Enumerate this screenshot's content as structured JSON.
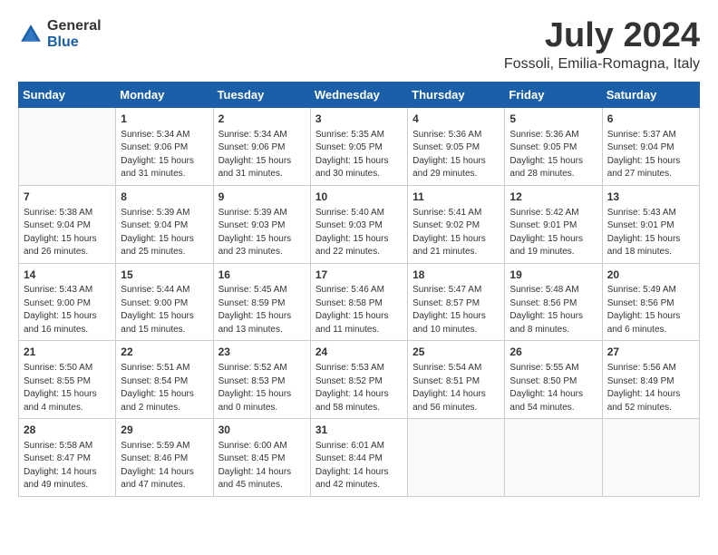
{
  "logo": {
    "general": "General",
    "blue": "Blue"
  },
  "title": "July 2024",
  "location": "Fossoli, Emilia-Romagna, Italy",
  "weekdays": [
    "Sunday",
    "Monday",
    "Tuesday",
    "Wednesday",
    "Thursday",
    "Friday",
    "Saturday"
  ],
  "weeks": [
    [
      {
        "day": "",
        "info": ""
      },
      {
        "day": "1",
        "info": "Sunrise: 5:34 AM\nSunset: 9:06 PM\nDaylight: 15 hours\nand 31 minutes."
      },
      {
        "day": "2",
        "info": "Sunrise: 5:34 AM\nSunset: 9:06 PM\nDaylight: 15 hours\nand 31 minutes."
      },
      {
        "day": "3",
        "info": "Sunrise: 5:35 AM\nSunset: 9:05 PM\nDaylight: 15 hours\nand 30 minutes."
      },
      {
        "day": "4",
        "info": "Sunrise: 5:36 AM\nSunset: 9:05 PM\nDaylight: 15 hours\nand 29 minutes."
      },
      {
        "day": "5",
        "info": "Sunrise: 5:36 AM\nSunset: 9:05 PM\nDaylight: 15 hours\nand 28 minutes."
      },
      {
        "day": "6",
        "info": "Sunrise: 5:37 AM\nSunset: 9:04 PM\nDaylight: 15 hours\nand 27 minutes."
      }
    ],
    [
      {
        "day": "7",
        "info": "Sunrise: 5:38 AM\nSunset: 9:04 PM\nDaylight: 15 hours\nand 26 minutes."
      },
      {
        "day": "8",
        "info": "Sunrise: 5:39 AM\nSunset: 9:04 PM\nDaylight: 15 hours\nand 25 minutes."
      },
      {
        "day": "9",
        "info": "Sunrise: 5:39 AM\nSunset: 9:03 PM\nDaylight: 15 hours\nand 23 minutes."
      },
      {
        "day": "10",
        "info": "Sunrise: 5:40 AM\nSunset: 9:03 PM\nDaylight: 15 hours\nand 22 minutes."
      },
      {
        "day": "11",
        "info": "Sunrise: 5:41 AM\nSunset: 9:02 PM\nDaylight: 15 hours\nand 21 minutes."
      },
      {
        "day": "12",
        "info": "Sunrise: 5:42 AM\nSunset: 9:01 PM\nDaylight: 15 hours\nand 19 minutes."
      },
      {
        "day": "13",
        "info": "Sunrise: 5:43 AM\nSunset: 9:01 PM\nDaylight: 15 hours\nand 18 minutes."
      }
    ],
    [
      {
        "day": "14",
        "info": "Sunrise: 5:43 AM\nSunset: 9:00 PM\nDaylight: 15 hours\nand 16 minutes."
      },
      {
        "day": "15",
        "info": "Sunrise: 5:44 AM\nSunset: 9:00 PM\nDaylight: 15 hours\nand 15 minutes."
      },
      {
        "day": "16",
        "info": "Sunrise: 5:45 AM\nSunset: 8:59 PM\nDaylight: 15 hours\nand 13 minutes."
      },
      {
        "day": "17",
        "info": "Sunrise: 5:46 AM\nSunset: 8:58 PM\nDaylight: 15 hours\nand 11 minutes."
      },
      {
        "day": "18",
        "info": "Sunrise: 5:47 AM\nSunset: 8:57 PM\nDaylight: 15 hours\nand 10 minutes."
      },
      {
        "day": "19",
        "info": "Sunrise: 5:48 AM\nSunset: 8:56 PM\nDaylight: 15 hours\nand 8 minutes."
      },
      {
        "day": "20",
        "info": "Sunrise: 5:49 AM\nSunset: 8:56 PM\nDaylight: 15 hours\nand 6 minutes."
      }
    ],
    [
      {
        "day": "21",
        "info": "Sunrise: 5:50 AM\nSunset: 8:55 PM\nDaylight: 15 hours\nand 4 minutes."
      },
      {
        "day": "22",
        "info": "Sunrise: 5:51 AM\nSunset: 8:54 PM\nDaylight: 15 hours\nand 2 minutes."
      },
      {
        "day": "23",
        "info": "Sunrise: 5:52 AM\nSunset: 8:53 PM\nDaylight: 15 hours\nand 0 minutes."
      },
      {
        "day": "24",
        "info": "Sunrise: 5:53 AM\nSunset: 8:52 PM\nDaylight: 14 hours\nand 58 minutes."
      },
      {
        "day": "25",
        "info": "Sunrise: 5:54 AM\nSunset: 8:51 PM\nDaylight: 14 hours\nand 56 minutes."
      },
      {
        "day": "26",
        "info": "Sunrise: 5:55 AM\nSunset: 8:50 PM\nDaylight: 14 hours\nand 54 minutes."
      },
      {
        "day": "27",
        "info": "Sunrise: 5:56 AM\nSunset: 8:49 PM\nDaylight: 14 hours\nand 52 minutes."
      }
    ],
    [
      {
        "day": "28",
        "info": "Sunrise: 5:58 AM\nSunset: 8:47 PM\nDaylight: 14 hours\nand 49 minutes."
      },
      {
        "day": "29",
        "info": "Sunrise: 5:59 AM\nSunset: 8:46 PM\nDaylight: 14 hours\nand 47 minutes."
      },
      {
        "day": "30",
        "info": "Sunrise: 6:00 AM\nSunset: 8:45 PM\nDaylight: 14 hours\nand 45 minutes."
      },
      {
        "day": "31",
        "info": "Sunrise: 6:01 AM\nSunset: 8:44 PM\nDaylight: 14 hours\nand 42 minutes."
      },
      {
        "day": "",
        "info": ""
      },
      {
        "day": "",
        "info": ""
      },
      {
        "day": "",
        "info": ""
      }
    ]
  ]
}
